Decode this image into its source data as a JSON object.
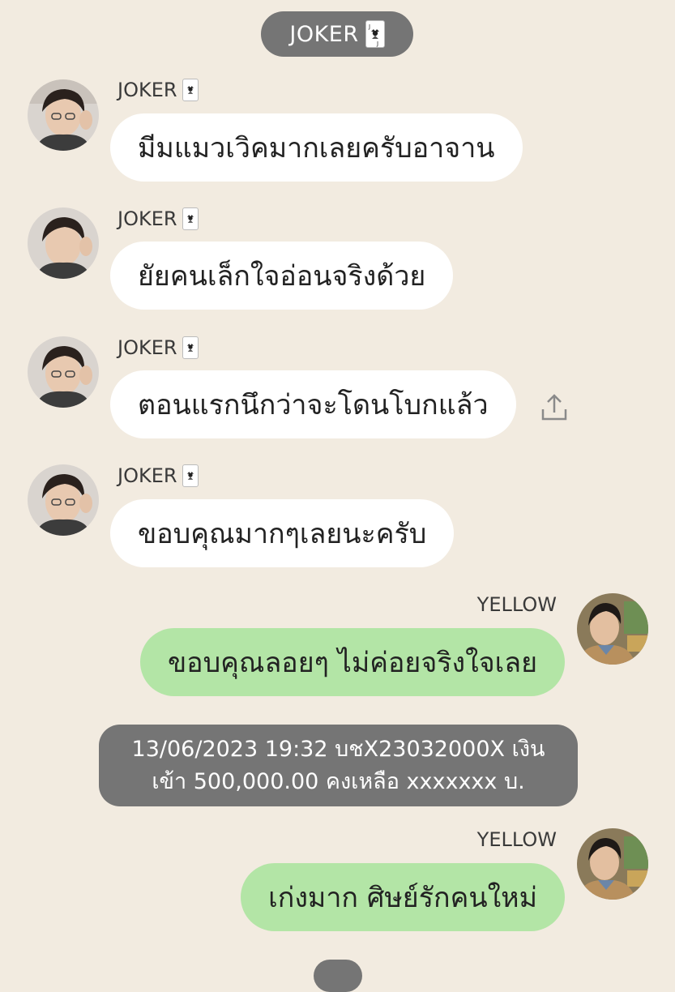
{
  "header": {
    "title": "JOKER"
  },
  "messages": [
    {
      "sender": "JOKER",
      "text": "มีมแมวเวิคมากเลยครับอาจาน"
    },
    {
      "sender": "JOKER",
      "text": "ยัยคนเล็กใจอ่อนจริงด้วย"
    },
    {
      "sender": "JOKER",
      "text": "ตอนแรกนึกว่าจะโดนโบกแล้ว"
    },
    {
      "sender": "JOKER",
      "text": "ขอบคุณมากๆเลยนะครับ"
    },
    {
      "sender": "YELLOW",
      "text": "ขอบคุณลอยๆ ไม่ค่อยจริงใจเลย"
    },
    {
      "sender": "YELLOW",
      "text": "เก่งมาก ศิษย์รักคนใหม่"
    }
  ],
  "system": {
    "line1": "13/06/2023 19:32 บชX23032000X เงิน",
    "line2": "เข้า 500,000.00 คงเหลือ xxxxxxx บ."
  },
  "icons": {
    "header_badge": "joker-card-icon",
    "share": "share-icon"
  },
  "colors": {
    "background": "#f2ebe0",
    "incoming_bubble": "#ffffff",
    "outgoing_bubble": "#b3e5a6",
    "system_pill": "#757575"
  }
}
